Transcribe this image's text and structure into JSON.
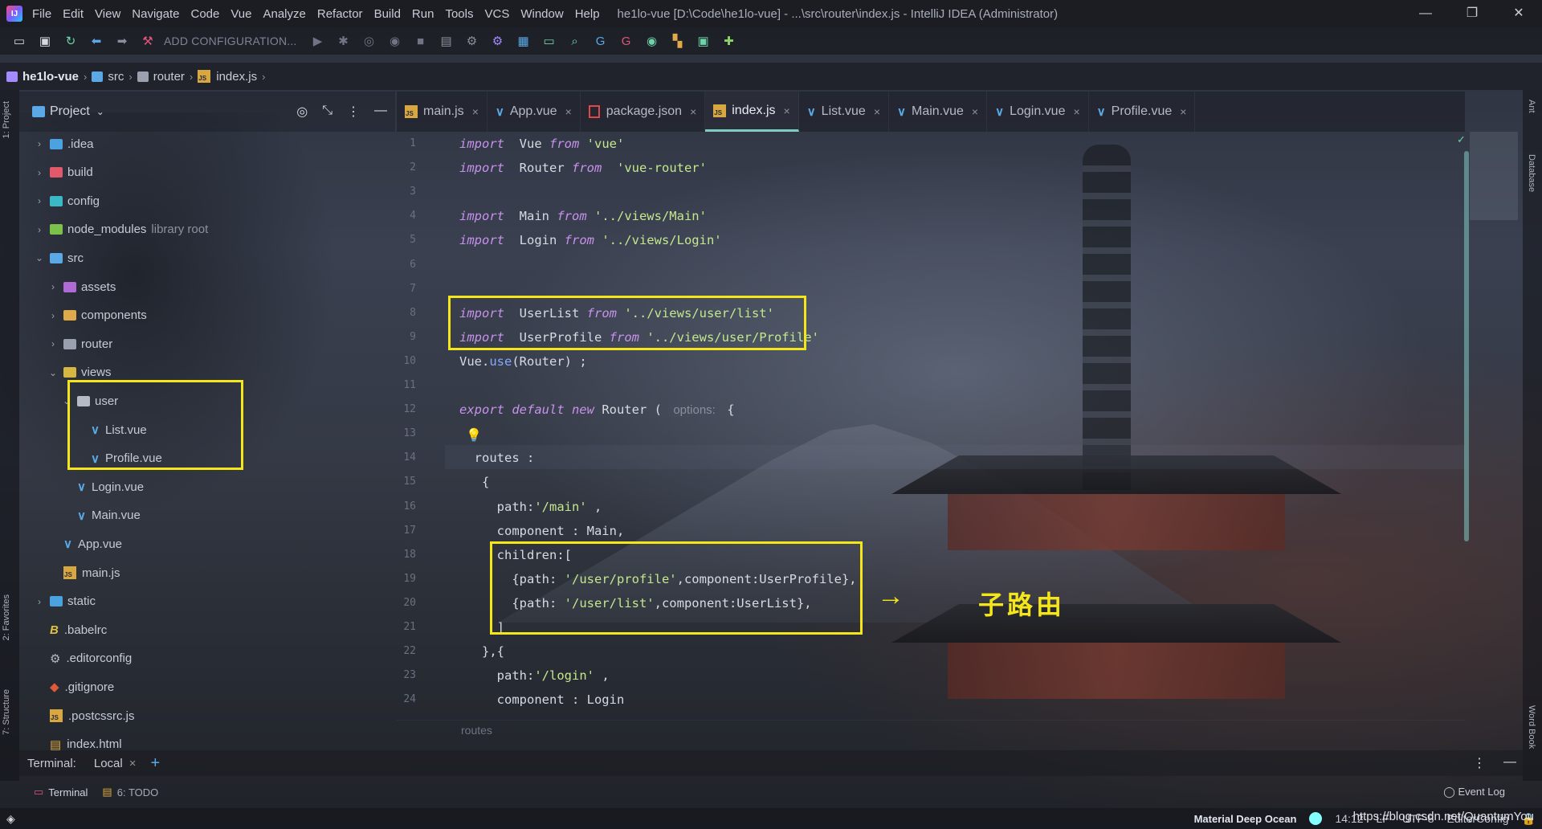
{
  "window": {
    "title": "he1lo-vue [D:\\Code\\he1lo-vue] - ...\\src\\router\\index.js - IntelliJ IDEA (Administrator)",
    "controls": [
      "—",
      "❐",
      "✕"
    ]
  },
  "menu": [
    "File",
    "Edit",
    "View",
    "Navigate",
    "Code",
    "Vue",
    "Analyze",
    "Refactor",
    "Build",
    "Run",
    "Tools",
    "VCS",
    "Window",
    "Help"
  ],
  "toolbar": {
    "run_config_label": "ADD CONFIGURATION...",
    "icons": [
      "open-folder-icon",
      "save-icon",
      "sync-icon",
      "back-icon",
      "forward-icon",
      "build-hammer-icon",
      "run-icon",
      "debug-icon",
      "coverage-icon",
      "profile-icon",
      "stop-icon",
      "project-structure-icon",
      "sdk-icon",
      "settings-icon",
      "layout-icon",
      "terminal-icon",
      "search-icon",
      "translate-icon",
      "translate-alt-icon",
      "plugin-icon",
      "grid-icon",
      "code-icon",
      "puzzle-icon"
    ]
  },
  "breadcrumb": [
    "he1lo-vue",
    "src",
    "router",
    "index.js"
  ],
  "project_panel": {
    "title": "Project",
    "tree": [
      {
        "label": ".idea",
        "depth": 0,
        "arrow": "›",
        "icon": "folder-blue"
      },
      {
        "label": "build",
        "depth": 0,
        "arrow": "›",
        "icon": "folder-red"
      },
      {
        "label": "config",
        "depth": 0,
        "arrow": "›",
        "icon": "folder-cyan"
      },
      {
        "label": "node_modules",
        "note": "library root",
        "depth": 0,
        "arrow": "›",
        "icon": "folder-green"
      },
      {
        "label": "src",
        "depth": 0,
        "arrow": "⌄",
        "icon": "folder-src"
      },
      {
        "label": "assets",
        "depth": 1,
        "arrow": "›",
        "icon": "folder-purple"
      },
      {
        "label": "components",
        "depth": 1,
        "arrow": "›",
        "icon": "folder-orange"
      },
      {
        "label": "router",
        "depth": 1,
        "arrow": "›",
        "icon": "folder-router"
      },
      {
        "label": "views",
        "depth": 1,
        "arrow": "⌄",
        "icon": "folder-yellow"
      },
      {
        "label": "user",
        "depth": 2,
        "arrow": "⌄",
        "icon": "folder-plain"
      },
      {
        "label": "List.vue",
        "depth": 3,
        "arrow": "",
        "icon": "vue"
      },
      {
        "label": "Profile.vue",
        "depth": 3,
        "arrow": "",
        "icon": "vue"
      },
      {
        "label": "Login.vue",
        "depth": 2,
        "arrow": "",
        "icon": "vue"
      },
      {
        "label": "Main.vue",
        "depth": 2,
        "arrow": "",
        "icon": "vue"
      },
      {
        "label": "App.vue",
        "depth": 1,
        "arrow": "",
        "icon": "vue"
      },
      {
        "label": "main.js",
        "depth": 1,
        "arrow": "",
        "icon": "js"
      },
      {
        "label": "static",
        "depth": 0,
        "arrow": "›",
        "icon": "folder-blue"
      },
      {
        "label": ".babelrc",
        "depth": 0,
        "arrow": "",
        "icon": "babel"
      },
      {
        "label": ".editorconfig",
        "depth": 0,
        "arrow": "",
        "icon": "editorconfig"
      },
      {
        "label": ".gitignore",
        "depth": 0,
        "arrow": "",
        "icon": "git"
      },
      {
        "label": ".postcssrc.js",
        "depth": 0,
        "arrow": "",
        "icon": "js"
      },
      {
        "label": "index.html",
        "depth": 0,
        "arrow": "",
        "icon": "html"
      }
    ]
  },
  "left_strip": [
    "1: Project",
    "2: Favorites",
    "7: Structure"
  ],
  "right_strip": [
    "Ant",
    "Database",
    "Word Book"
  ],
  "editor": {
    "tabs": [
      {
        "label": "main.js",
        "icon": "js",
        "active": false
      },
      {
        "label": "App.vue",
        "icon": "vue",
        "active": false
      },
      {
        "label": "package.json",
        "icon": "json",
        "active": false
      },
      {
        "label": "index.js",
        "icon": "js",
        "active": true
      },
      {
        "label": "List.vue",
        "icon": "vue",
        "active": false
      },
      {
        "label": "Main.vue",
        "icon": "vue",
        "active": false
      },
      {
        "label": "Login.vue",
        "icon": "vue",
        "active": false
      },
      {
        "label": "Profile.vue",
        "icon": "vue",
        "active": false
      }
    ],
    "close_glyph": "×",
    "line_numbers": [
      "1",
      "2",
      "3",
      "4",
      "5",
      "6",
      "7",
      "8",
      "9",
      "10",
      "11",
      "12",
      "13",
      "14",
      "15",
      "16",
      "17",
      "18",
      "19",
      "20",
      "21",
      "22",
      "23",
      "24"
    ],
    "lines": [
      [
        [
          "kw",
          "import"
        ],
        [
          "",
          "  Vue "
        ],
        [
          "kw",
          "from"
        ],
        [
          "str",
          " 'vue'"
        ]
      ],
      [
        [
          "kw",
          "import"
        ],
        [
          "",
          "  Router "
        ],
        [
          "kw",
          "from"
        ],
        [
          "str",
          "  'vue-router'"
        ]
      ],
      [],
      [
        [
          "kw",
          "import"
        ],
        [
          "",
          "  Main "
        ],
        [
          "kw",
          "from"
        ],
        [
          "str",
          " '../views/Main'"
        ]
      ],
      [
        [
          "kw",
          "import"
        ],
        [
          "",
          "  Login "
        ],
        [
          "kw",
          "from"
        ],
        [
          "str",
          " '../views/Login'"
        ]
      ],
      [],
      [],
      [
        [
          "kw",
          "import"
        ],
        [
          "",
          "  UserList "
        ],
        [
          "kw",
          "from"
        ],
        [
          "str",
          " '../views/user/list'"
        ]
      ],
      [
        [
          "kw",
          "import"
        ],
        [
          "",
          "  UserProfile "
        ],
        [
          "kw",
          "from"
        ],
        [
          "str",
          " '../views/user/Profile'"
        ]
      ],
      [
        [
          "",
          "Vue."
        ],
        [
          "fn",
          "use"
        ],
        [
          "",
          "(Router) ;"
        ]
      ],
      [],
      [
        [
          "kw",
          "export default new"
        ],
        [
          "",
          " Router ( "
        ],
        [
          "hint",
          "options:"
        ],
        [
          "",
          " {"
        ]
      ],
      [],
      [
        [
          "",
          "  routes :"
        ]
      ],
      [
        [
          "",
          "   {"
        ]
      ],
      [
        [
          "",
          "     path:"
        ],
        [
          "str",
          "'/main'"
        ],
        [
          "",
          " ,"
        ]
      ],
      [
        [
          "",
          "     component : Main,"
        ]
      ],
      [
        [
          "",
          "     children:["
        ]
      ],
      [
        [
          "",
          "       {path: "
        ],
        [
          "str",
          "'/user/profile'"
        ],
        [
          "",
          ",component:UserProfile},"
        ]
      ],
      [
        [
          "",
          "       {path: "
        ],
        [
          "str",
          "'/user/list'"
        ],
        [
          "",
          ",component:UserList},"
        ]
      ],
      [
        [
          "",
          "     ]"
        ]
      ],
      [
        [
          "",
          "   },{"
        ]
      ],
      [
        [
          "",
          "     path:"
        ],
        [
          "str",
          "'/login'"
        ],
        [
          "",
          " ,"
        ]
      ],
      [
        [
          "",
          "     component : Login"
        ]
      ]
    ],
    "footer_crumb": "routes"
  },
  "annotation": {
    "arrow": "→",
    "text": "子路由"
  },
  "terminal": {
    "label": "Terminal:",
    "tab": "Local",
    "add": "+"
  },
  "tool_tabs": [
    {
      "label": "Terminal",
      "icon": "terminal-icon"
    },
    {
      "label": "6: TODO",
      "icon": "todo-icon"
    }
  ],
  "event_log": "Event Log",
  "status": {
    "theme": "Material Deep Ocean",
    "position": "14:12",
    "line_sep": "LF",
    "encoding": "UTF-8",
    "editorconfig": "EditorConfig",
    "watermark": "https://blog.csdn.net/QuantumYou"
  },
  "colors": {
    "accent": "#80cbc4",
    "highlight": "#f5e61a",
    "keyword": "#c792ea",
    "string": "#c3e88d"
  }
}
